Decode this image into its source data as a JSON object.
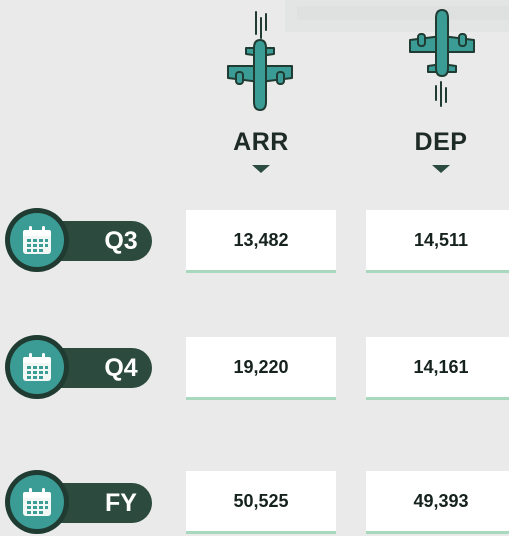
{
  "columns": [
    {
      "label": "ARR"
    },
    {
      "label": "DEP"
    }
  ],
  "rows": [
    {
      "label": "Q3",
      "arr": "13,482",
      "dep": "14,511"
    },
    {
      "label": "Q4",
      "arr": "19,220",
      "dep": "14,161"
    },
    {
      "label": "FY",
      "arr": "50,525",
      "dep": "49,393"
    }
  ],
  "colors": {
    "background": "#e9eae9",
    "plane_fill": "#3b9c95",
    "plane_outline": "#1f3b32",
    "pill": "#2c4a3e",
    "cell_underline": "#a8d9bf"
  },
  "icons": {
    "arrival": "airplane-descending-icon",
    "departure": "airplane-ascending-icon",
    "row": "calendar-icon"
  }
}
